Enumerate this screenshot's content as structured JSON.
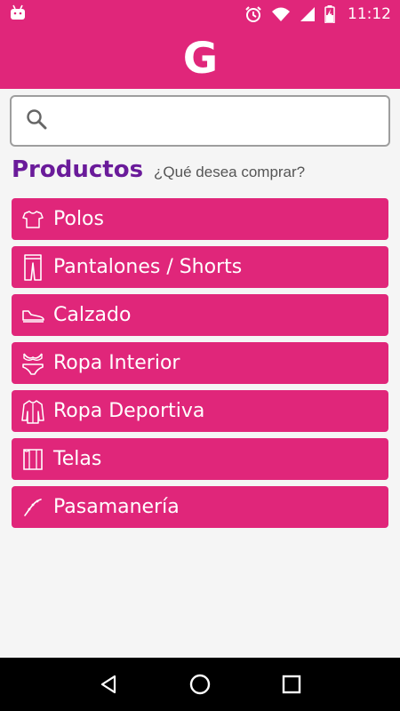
{
  "status_bar": {
    "time": "11:12",
    "icons": [
      "android-icon",
      "alarm-icon",
      "wifi-icon",
      "signal-icon",
      "battery-charging-icon"
    ]
  },
  "app_bar": {
    "logo": "G"
  },
  "search": {
    "value": "",
    "placeholder": ""
  },
  "section": {
    "title": "Productos",
    "subtitle": "¿Qué desea comprar?"
  },
  "categories": [
    {
      "label": "Polos",
      "icon": "tshirt-icon"
    },
    {
      "label": "Pantalones / Shorts",
      "icon": "pants-icon"
    },
    {
      "label": "Calzado",
      "icon": "shoe-icon"
    },
    {
      "label": "Ropa Interior",
      "icon": "underwear-icon"
    },
    {
      "label": "Ropa Deportiva",
      "icon": "jacket-icon"
    },
    {
      "label": "Telas",
      "icon": "fabric-icon"
    },
    {
      "label": "Pasamanería",
      "icon": "trim-icon"
    }
  ],
  "colors": {
    "accent": "#e0267a",
    "title": "#6a1b9a",
    "background": "#f5f5f5"
  },
  "nav": {
    "icons": [
      "back-icon",
      "home-icon",
      "recents-icon"
    ]
  }
}
